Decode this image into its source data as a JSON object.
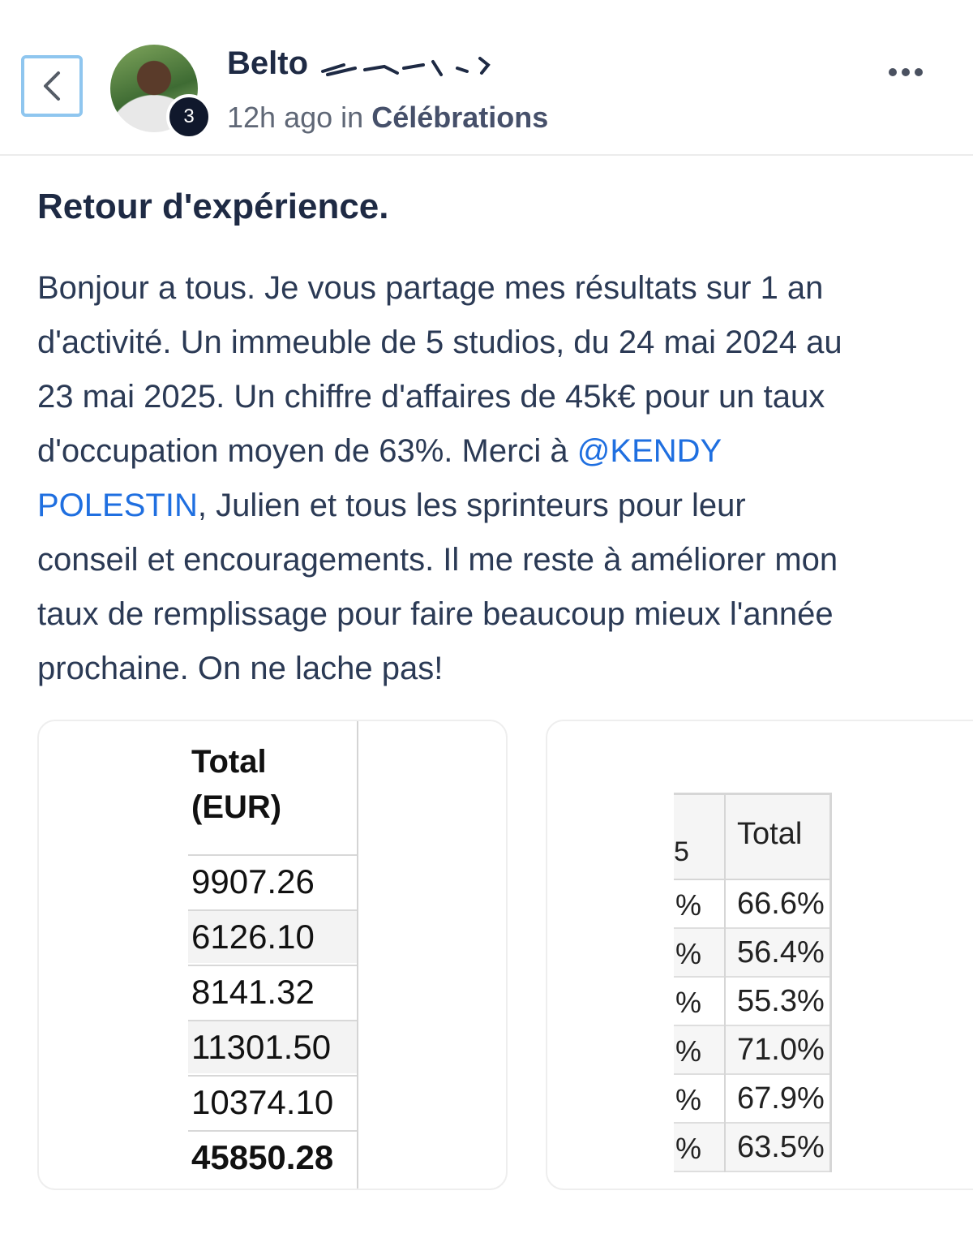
{
  "header": {
    "author_name": "Belto",
    "level": "3",
    "time_ago": "12h ago",
    "in_word": "in",
    "category": "Célébrations"
  },
  "post": {
    "title": "Retour d'expérience.",
    "lines": [
      "Bonjour a tous. Je vous partage mes résultats sur 1 an",
      "d'activité. Un immeuble de 5 studios, du 24 mai 2024 au",
      "23 mai 2025. Un chiffre d'affaires de 45k€ pour un taux"
    ],
    "line4_text": "d'occupation moyen de 63%. Merci à ",
    "mention_part1": "@KENDY",
    "mention_part2": "POLESTIN",
    "line5_rest": ", Julien et tous les sprinteurs pour leur",
    "lines_after": [
      "conseil et encouragements. Il me reste à améliorer mon",
      "taux de remplissage pour faire beaucoup mieux l'année",
      "prochaine. On ne lache pas!"
    ]
  },
  "image1": {
    "header_line1": "Total",
    "header_line2": "(EUR)",
    "values": [
      "9907.26",
      "6126.10",
      "8141.32",
      "11301.50",
      "10374.10"
    ],
    "total": "45850.28"
  },
  "image2": {
    "header": "Total",
    "header_fragment": "5",
    "pct_fragment": "%",
    "values": [
      "66.6%",
      "56.4%",
      "55.3%",
      "71.0%",
      "67.9%",
      "63.5%"
    ]
  }
}
